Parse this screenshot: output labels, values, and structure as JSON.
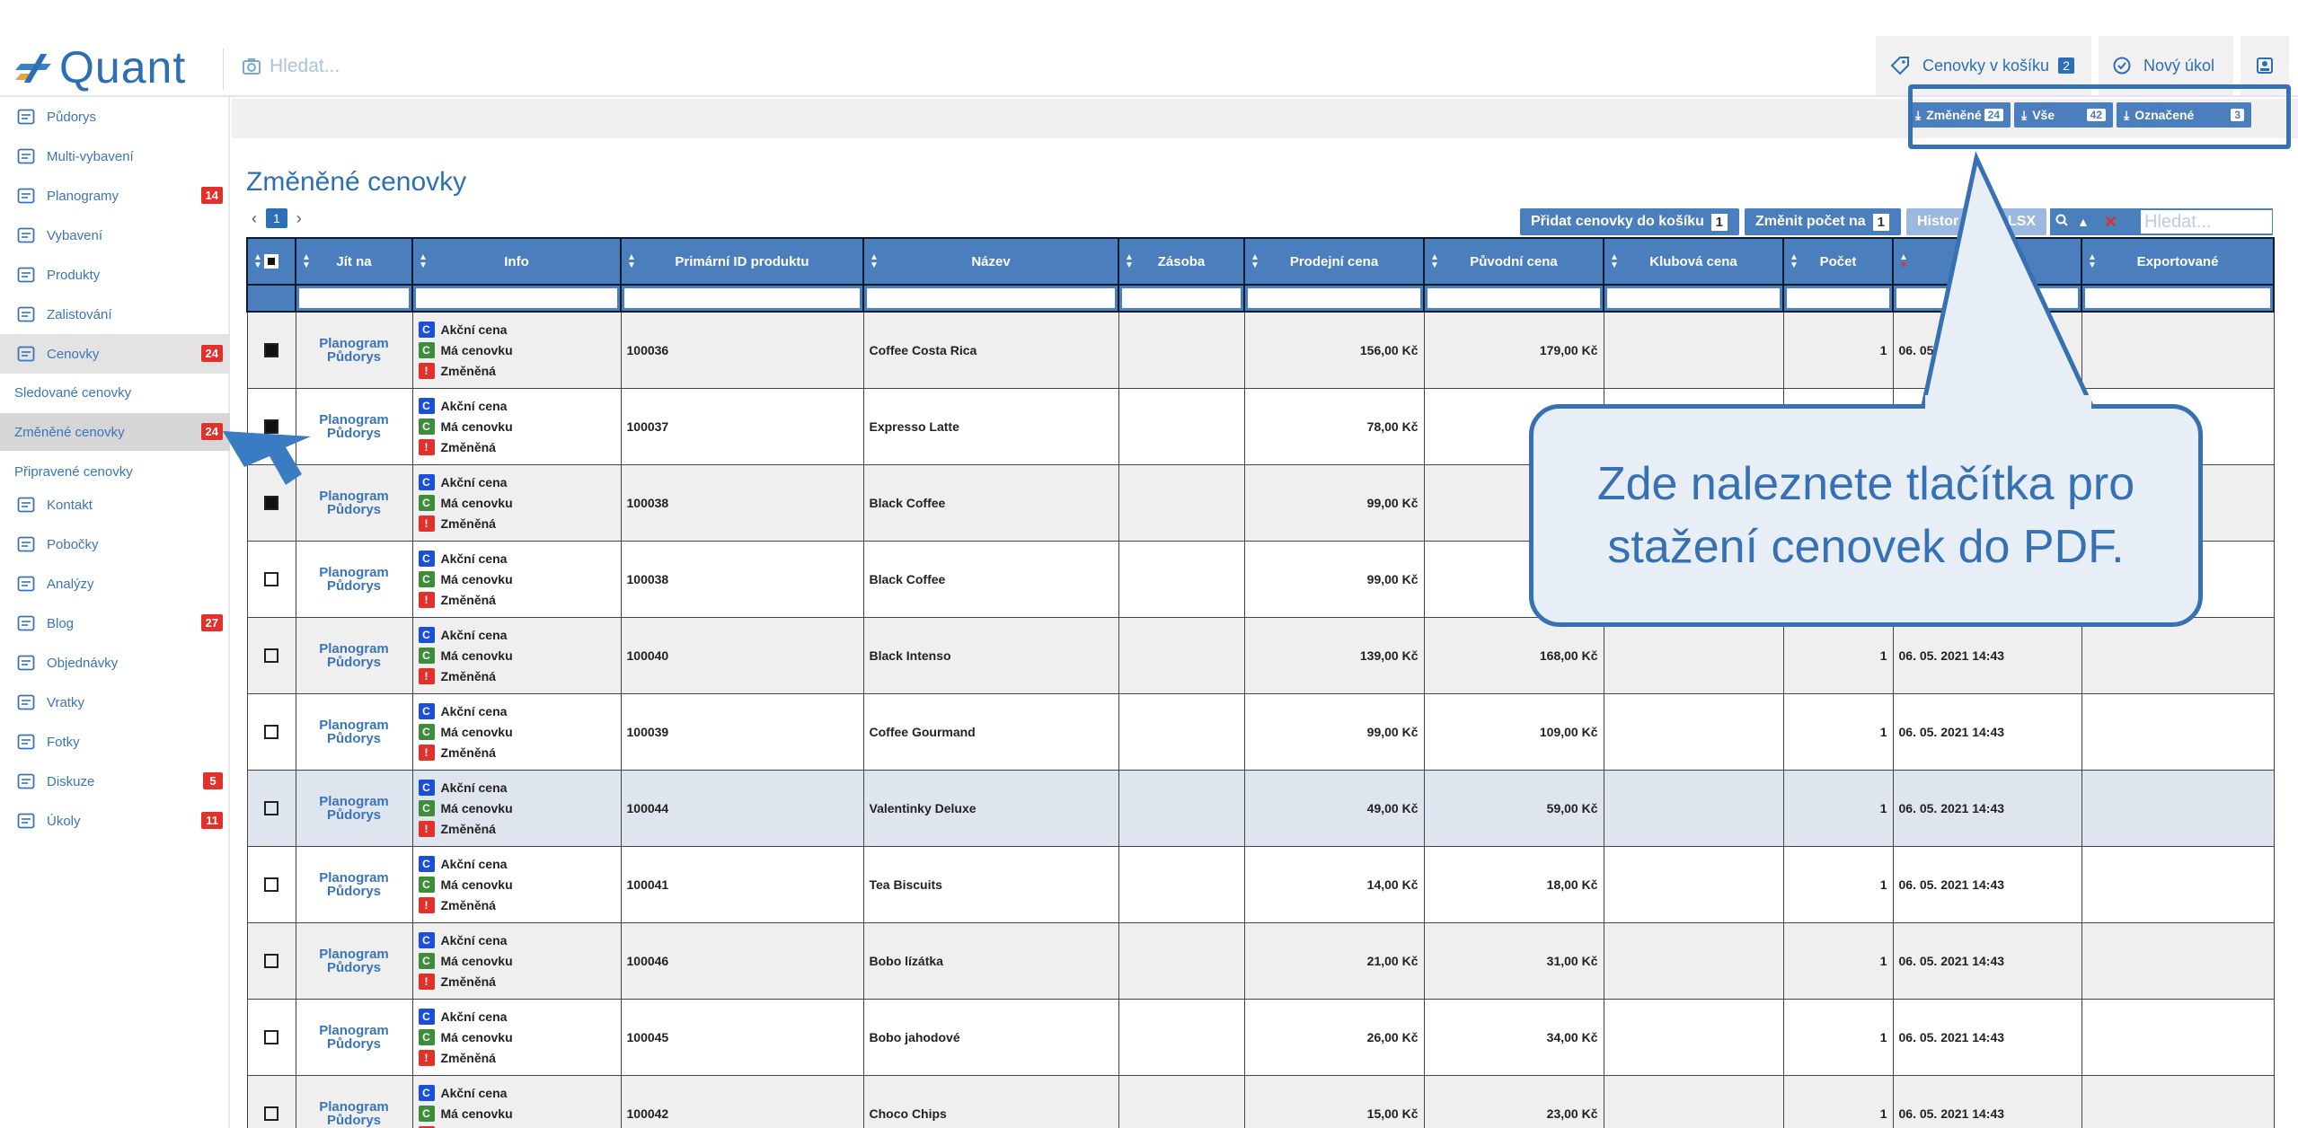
{
  "app": {
    "logo": "Quant"
  },
  "header": {
    "search_placeholder": "Hledat...",
    "cart_label": "Cenovky v košíku",
    "cart_count": "2",
    "new_task_label": "Nový úkol"
  },
  "sidebar": {
    "items": [
      {
        "label": "Půdorys",
        "icon": "floorplan-icon",
        "count": ""
      },
      {
        "label": "Multi-vybavení",
        "icon": "building-icon",
        "count": ""
      },
      {
        "label": "Planogramy",
        "icon": "planogram-icon",
        "count": "14"
      },
      {
        "label": "Vybavení",
        "icon": "equipment-icon",
        "count": ""
      },
      {
        "label": "Produkty",
        "icon": "products-icon",
        "count": ""
      },
      {
        "label": "Zalistování",
        "icon": "listing-icon",
        "count": ""
      },
      {
        "label": "Cenovky",
        "icon": "tag-icon",
        "count": "24"
      },
      {
        "label": "Kontakt",
        "icon": "contact-icon",
        "count": ""
      },
      {
        "label": "Pobočky",
        "icon": "branch-icon",
        "count": ""
      },
      {
        "label": "Analýzy",
        "icon": "chart-icon",
        "count": ""
      },
      {
        "label": "Blog",
        "icon": "blog-icon",
        "count": "27"
      },
      {
        "label": "Objednávky",
        "icon": "orders-icon",
        "count": ""
      },
      {
        "label": "Vratky",
        "icon": "returns-icon",
        "count": ""
      },
      {
        "label": "Fotky",
        "icon": "photo-icon",
        "count": ""
      },
      {
        "label": "Diskuze",
        "icon": "discussion-icon",
        "count": "5"
      },
      {
        "label": "Úkoly",
        "icon": "tasks-icon",
        "count": "11"
      }
    ],
    "sub_items": [
      {
        "label": "Sledované cenovky",
        "count": ""
      },
      {
        "label": "Změněné cenovky",
        "count": "24"
      },
      {
        "label": "Připravené cenovky",
        "count": ""
      }
    ]
  },
  "downloads": {
    "changed_label": "Změněné",
    "changed_count": "24",
    "all_label": "Vše",
    "all_count": "42",
    "marked_label": "Označené",
    "marked_count": "3"
  },
  "page": {
    "title": "Změněné cenovky",
    "current_page": "1",
    "add_to_cart_label": "Přidat cenovky do košíku",
    "add_to_cart_count": "1",
    "change_count_label": "Změnit počet na",
    "change_count_value": "1",
    "history_label": "Histor",
    "xlsx_label": "LSX",
    "search_placeholder": "Hledat..."
  },
  "table": {
    "columns": [
      "",
      "Jít na",
      "Info",
      "Primární ID produktu",
      "Název",
      "Zásoba",
      "Prodejní cena",
      "Původní cena",
      "Klubová cena",
      "Počet",
      "",
      "Exportované"
    ],
    "goto_line1": "Planogram",
    "goto_line2": "Půdorys",
    "info": {
      "c1": "Akční cena",
      "c2": "Má cenovku",
      "c3": "Změněná"
    },
    "rows": [
      {
        "checked": true,
        "id": "100036",
        "name": "Coffee Costa Rica",
        "price": "156,00 Kč",
        "orig": "179,00 Kč",
        "count": "1",
        "date": "06. 05. 2021 14:43"
      },
      {
        "checked": true,
        "id": "100037",
        "name": "Expresso Latte",
        "price": "78,00 Kč",
        "orig": "",
        "count": "",
        "date": ""
      },
      {
        "checked": true,
        "id": "100038",
        "name": "Black Coffee",
        "price": "99,00 Kč",
        "orig": "",
        "count": "",
        "date": ""
      },
      {
        "checked": false,
        "id": "100038",
        "name": "Black Coffee",
        "price": "99,00 Kč",
        "orig": "",
        "count": "",
        "date": ""
      },
      {
        "checked": false,
        "id": "100040",
        "name": "Black Intenso",
        "price": "139,00 Kč",
        "orig": "168,00 Kč",
        "count": "1",
        "date": "06. 05. 2021 14:43"
      },
      {
        "checked": false,
        "id": "100039",
        "name": "Coffee Gourmand",
        "price": "99,00 Kč",
        "orig": "109,00 Kč",
        "count": "1",
        "date": "06. 05. 2021 14:43"
      },
      {
        "checked": false,
        "id": "100044",
        "name": "Valentinky Deluxe",
        "price": "49,00 Kč",
        "orig": "59,00 Kč",
        "count": "1",
        "date": "06. 05. 2021 14:43"
      },
      {
        "checked": false,
        "id": "100041",
        "name": "Tea Biscuits",
        "price": "14,00 Kč",
        "orig": "18,00 Kč",
        "count": "1",
        "date": "06. 05. 2021 14:43"
      },
      {
        "checked": false,
        "id": "100046",
        "name": "Bobo lízátka",
        "price": "21,00 Kč",
        "orig": "31,00 Kč",
        "count": "1",
        "date": "06. 05. 2021 14:43"
      },
      {
        "checked": false,
        "id": "100045",
        "name": "Bobo jahodové",
        "price": "26,00 Kč",
        "orig": "34,00 Kč",
        "count": "1",
        "date": "06. 05. 2021 14:43"
      },
      {
        "checked": false,
        "id": "100042",
        "name": "Choco Chips",
        "price": "15,00 Kč",
        "orig": "23,00 Kč",
        "count": "1",
        "date": "06. 05. 2021 14:43"
      }
    ]
  },
  "callout": {
    "line1": "Zde naleznete tlačítka pro",
    "line2": "stažení cenovek do PDF."
  },
  "colors": {
    "accent": "#2c6fb4",
    "header_blue": "#4a7ebd",
    "badge_red": "#e0312b"
  }
}
